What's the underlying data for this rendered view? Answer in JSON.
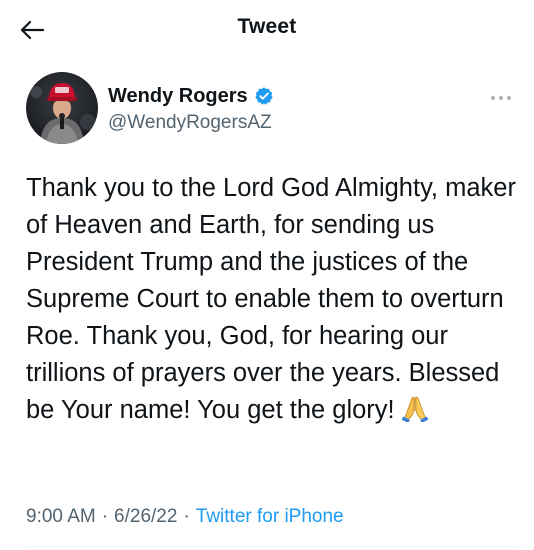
{
  "header": {
    "title": "Tweet",
    "back_icon": "arrow-left-icon"
  },
  "author": {
    "display_name": "Wendy Rogers",
    "handle": "@WendyRogersAZ",
    "verified": true,
    "verified_color": "#1d9bf0",
    "avatar_icon": "profile-photo"
  },
  "tweet": {
    "text": "Thank you to the Lord God Almighty, maker of Heaven and Earth, for sending us President Trump and the justices of the Supreme Court to enable them to overturn Roe. Thank you, God, for hearing our trillions of prayers over the years. Blessed be Your name! You get the glory!",
    "emoji_icon": "folded-hands-icon"
  },
  "meta": {
    "time": "9:00 AM",
    "separator": "·",
    "date": "6/26/22",
    "source": "Twitter for iPhone",
    "source_color": "#1d9bf0"
  }
}
